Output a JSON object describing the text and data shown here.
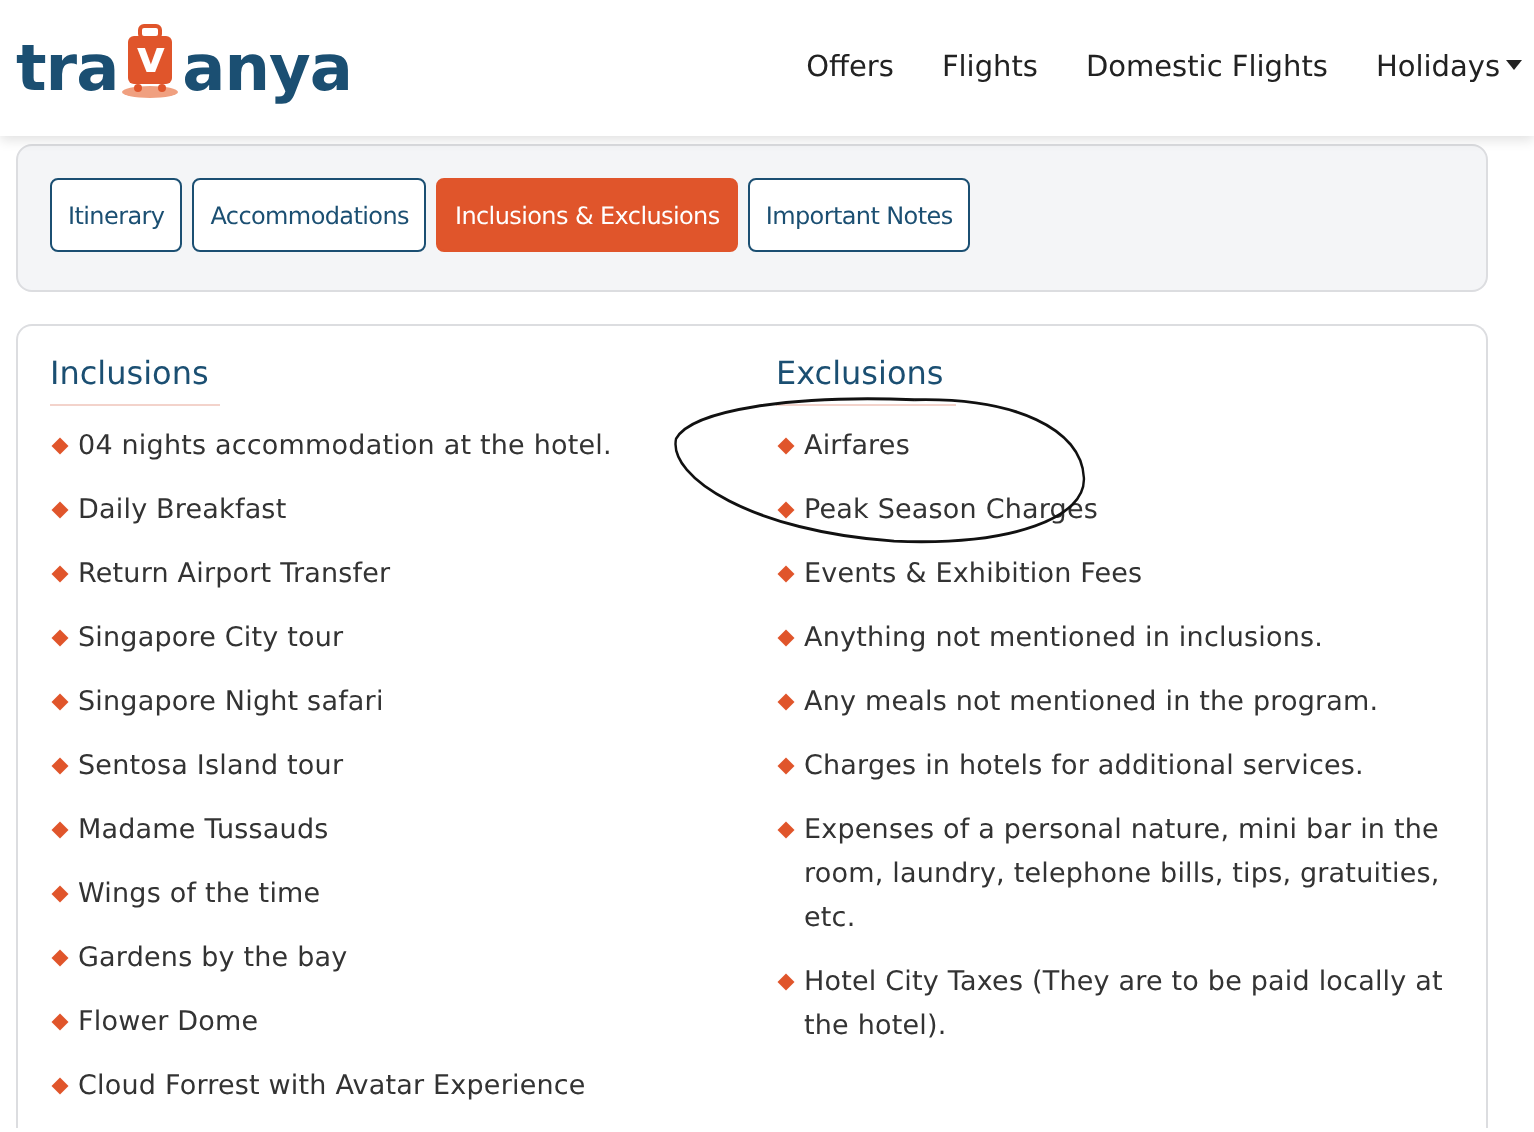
{
  "logo": {
    "before": "tra",
    "badge": "v",
    "after": "anya"
  },
  "nav": [
    {
      "label": "Offers",
      "dropdown": false
    },
    {
      "label": "Flights",
      "dropdown": false
    },
    {
      "label": "Domestic Flights",
      "dropdown": false
    },
    {
      "label": "Holidays",
      "dropdown": true
    }
  ],
  "tabs": [
    {
      "label": "Itinerary",
      "selected": false
    },
    {
      "label": "Accommodations",
      "selected": false
    },
    {
      "label": "Inclusions & Exclusions",
      "selected": true
    },
    {
      "label": "Important Notes",
      "selected": false
    }
  ],
  "inclusions": {
    "title": "Inclusions",
    "items": [
      {
        "text": "04 nights accommodation at the hotel.",
        "circled": false
      },
      {
        "text": "Daily Breakfast",
        "circled": false
      },
      {
        "text": "Return Airport Transfer",
        "circled": false
      },
      {
        "text": "Singapore City tour",
        "circled": false
      },
      {
        "text": "Singapore Night safari",
        "circled": false
      },
      {
        "text": "Sentosa Island tour",
        "circled": false
      },
      {
        "text": "Madame Tussauds",
        "circled": false
      },
      {
        "text": "Wings of the time",
        "circled": false
      },
      {
        "text": "Gardens by the bay",
        "circled": false
      },
      {
        "text": "Flower Dome",
        "circled": false
      },
      {
        "text": "Cloud Forrest with Avatar Experience",
        "circled": false
      }
    ]
  },
  "exclusions": {
    "title": "Exclusions",
    "items": [
      {
        "text": "Airfares",
        "circled": true
      },
      {
        "text": "Peak Season Charges",
        "circled": true
      },
      {
        "text": "Events & Exhibition Fees",
        "circled": false
      },
      {
        "text": "Anything not mentioned in inclusions.",
        "circled": false
      },
      {
        "text": "Any meals not mentioned in the program.",
        "circled": false
      },
      {
        "text": "Charges in hotels for additional services.",
        "circled": false
      },
      {
        "text": "Expenses of a personal nature, mini bar in the room, laundry, telephone bills, tips, gratuities, etc.",
        "circled": false
      },
      {
        "text": "Hotel City Taxes (They are to be paid locally at the hotel).",
        "circled": false
      }
    ]
  }
}
